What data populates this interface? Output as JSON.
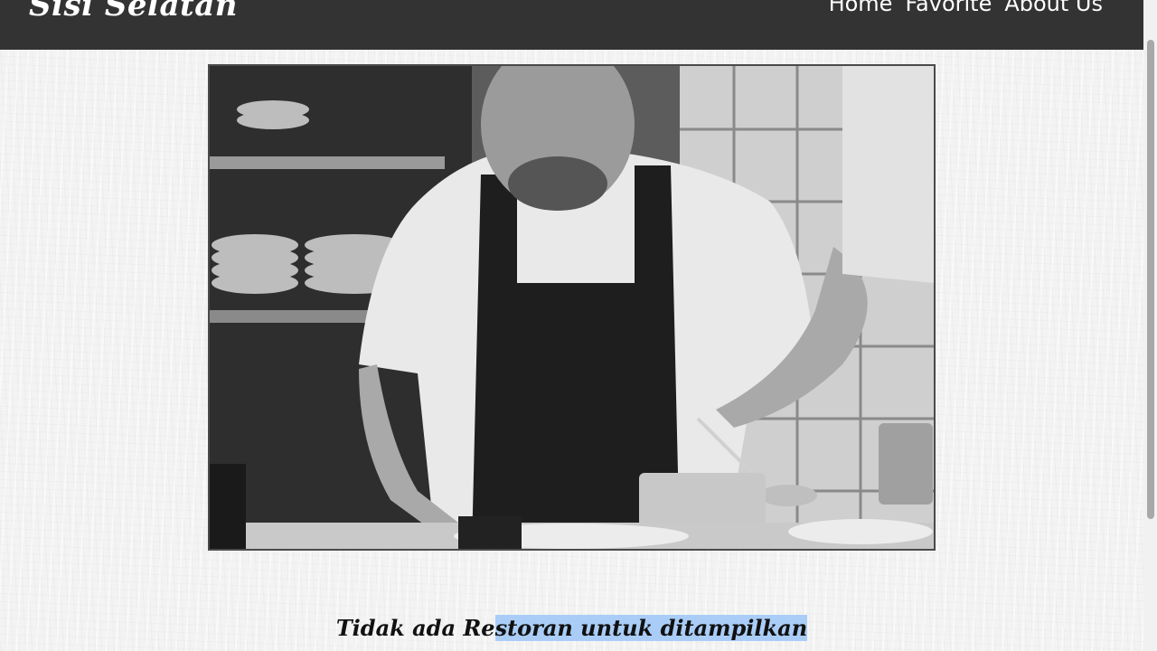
{
  "header": {
    "brand": "Sisi Selatan",
    "nav": [
      {
        "label": "Home"
      },
      {
        "label": "Favorite"
      },
      {
        "label": "About Us"
      }
    ]
  },
  "hero": {
    "image_subject": "chef-plating-food-black-and-white"
  },
  "main": {
    "empty_message_part1": "Tidak ada Re",
    "empty_message_part2": "storan untuk ditampilkan"
  },
  "colors": {
    "header_bg": "#333333",
    "header_text": "#ffffff",
    "selection_highlight": "#a9cdf7"
  }
}
